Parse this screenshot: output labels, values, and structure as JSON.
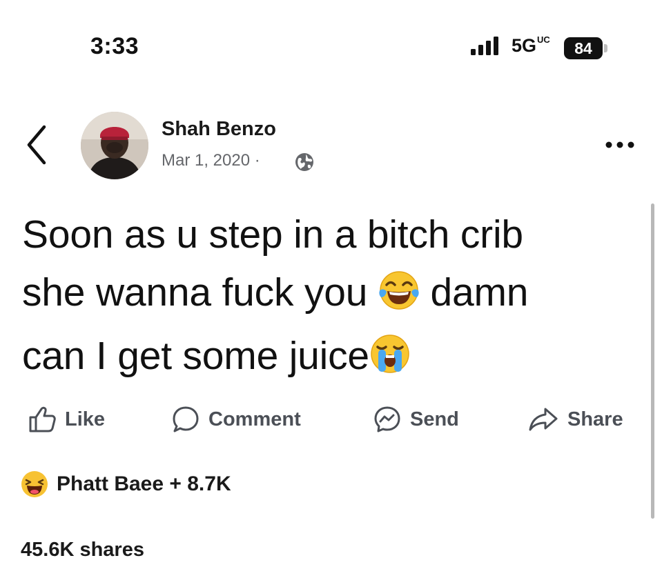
{
  "status_bar": {
    "time": "3:33",
    "network": "5G",
    "network_sup": "UC",
    "battery": "84"
  },
  "post": {
    "author": "Shah Benzo",
    "date": "Mar 1, 2020 ·",
    "privacy_icon": "globe-icon",
    "text_lines": [
      "Soon as u step in a bitch crib",
      "she wanna fuck you",
      "damn",
      "can I get some juice"
    ],
    "emojis": [
      "face-with-tears-of-joy",
      "loudly-crying-face"
    ]
  },
  "actions": {
    "like": "Like",
    "comment": "Comment",
    "send": "Send",
    "share": "Share"
  },
  "reactions": {
    "icon": "haha-reaction",
    "text": "Phatt Baee + 8.7K"
  },
  "shares": "45.6K shares"
}
